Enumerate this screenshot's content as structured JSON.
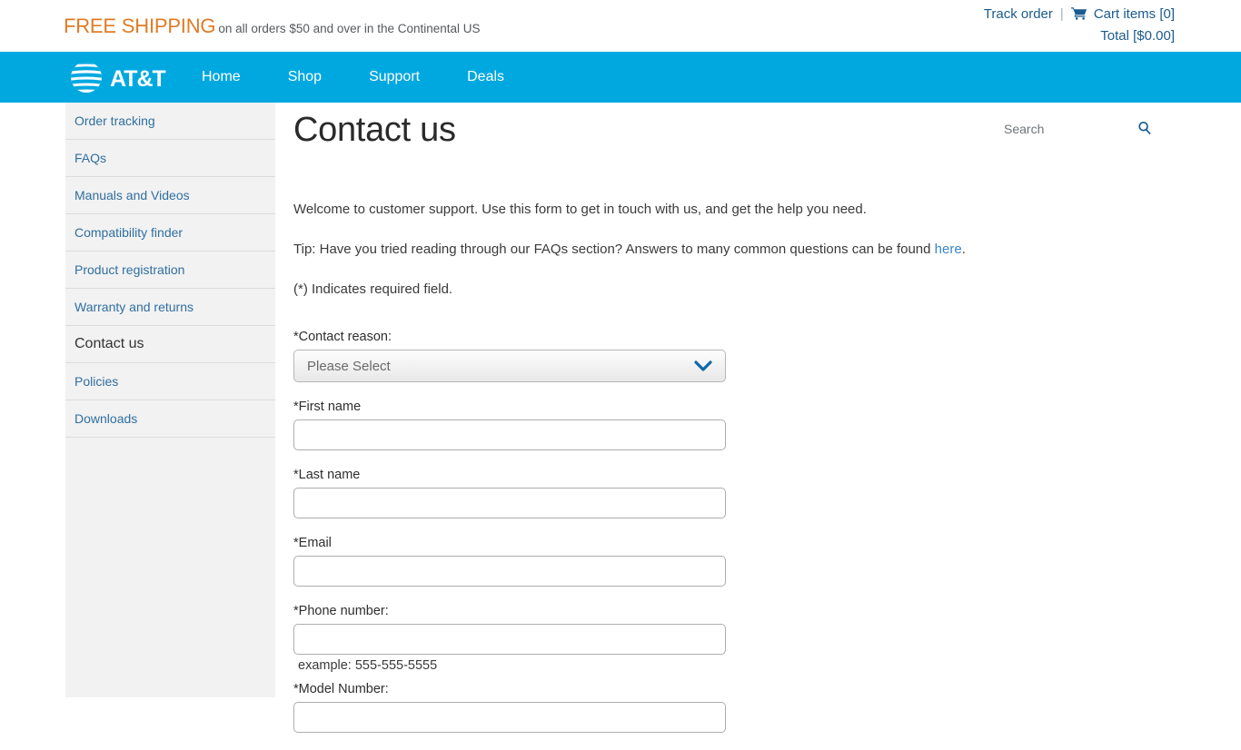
{
  "promo": {
    "strong": "FREE SHIPPING",
    "rest": "on all orders $50 and over in the Continental US"
  },
  "account": {
    "track_order": "Track order",
    "separator": "|",
    "cart_icon": "shopping-cart-icon",
    "cart_items": "Cart items [0]",
    "total": "Total [$0.00]"
  },
  "nav": {
    "brand": "AT&T",
    "brand_logo_icon": "att-globe-icon",
    "links": [
      {
        "label": "Home"
      },
      {
        "label": "Shop"
      },
      {
        "label": "Support"
      },
      {
        "label": "Deals"
      }
    ]
  },
  "search": {
    "placeholder": "Search",
    "value": "",
    "icon": "search-icon"
  },
  "sidebar": {
    "items": [
      {
        "label": "Order tracking",
        "active": false
      },
      {
        "label": "FAQs",
        "active": false
      },
      {
        "label": "Manuals and Videos",
        "active": false
      },
      {
        "label": "Compatibility finder",
        "active": false
      },
      {
        "label": "Product registration",
        "active": false
      },
      {
        "label": "Warranty and returns",
        "active": false
      },
      {
        "label": "Contact us",
        "active": true
      },
      {
        "label": "Policies",
        "active": false
      },
      {
        "label": "Downloads",
        "active": false
      }
    ]
  },
  "main": {
    "title": "Contact us",
    "intro": "Welcome to customer support. Use this form to get in touch with us, and get the help you need.",
    "tip_before": "Tip: Have you tried reading through our FAQs section? Answers to many common questions can be found ",
    "tip_link": "here",
    "tip_after": ".",
    "required_note": "(*) Indicates required field."
  },
  "form": {
    "contact_reason": {
      "label": "*Contact reason:",
      "selected": "Please Select",
      "chevron_icon": "chevron-down-icon"
    },
    "first_name": {
      "label": "*First name",
      "value": ""
    },
    "last_name": {
      "label": "*Last name",
      "value": ""
    },
    "email": {
      "label": "*Email",
      "value": ""
    },
    "phone": {
      "label": "*Phone number:",
      "value": "",
      "hint": "example: 555-555-5555"
    },
    "model_number": {
      "label": "*Model Number:",
      "value": ""
    }
  },
  "colors": {
    "brand_blue": "#00a8e0",
    "promo_orange": "#e07b26",
    "link_blue": "#2f6f9f",
    "sidebar_bg": "#f2f2f2"
  }
}
